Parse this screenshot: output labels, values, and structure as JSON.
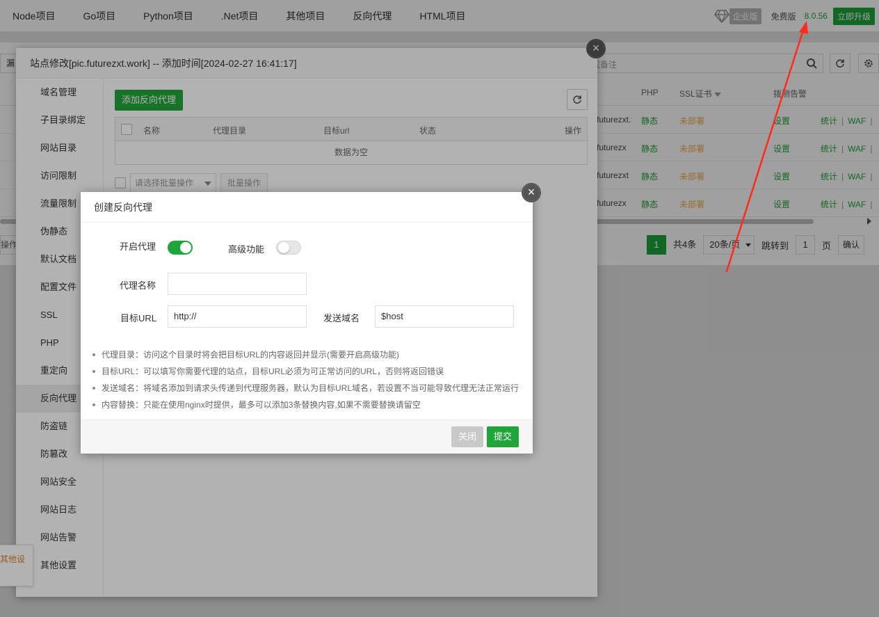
{
  "topnav": {
    "tabs": [
      "Node项目",
      "Go项目",
      "Python项目",
      ".Net项目",
      "其他项目",
      "反向代理",
      "HTML项目"
    ],
    "enterprise_badge": "企业版",
    "free_label": "免费版",
    "version": "8.0.56",
    "upgrade_label": "立即升级"
  },
  "background": {
    "left_button_text": "漏",
    "search_placeholder": "或备注",
    "columns": {
      "php": "PHP",
      "ssl": "SSL证书",
      "monitor": "拨测告警"
    },
    "rows": [
      {
        "domain": "futurezxt.v",
        "php": "静态",
        "ssl": "未部署",
        "settings": "设置",
        "stats": "统计",
        "waf": "WAF"
      },
      {
        "domain": "futurezx",
        "php": "静态",
        "ssl": "未部署",
        "settings": "设置",
        "stats": "统计",
        "waf": "WAF"
      },
      {
        "domain": "futurezxt",
        "php": "静态",
        "ssl": "未部署",
        "settings": "设置",
        "stats": "统计",
        "waf": "WAF"
      },
      {
        "domain": "futurezx",
        "php": "静态",
        "ssl": "未部署",
        "settings": "设置",
        "stats": "统计",
        "waf": "WAF"
      }
    ],
    "left_op_text": "操作",
    "pager": {
      "current": "1",
      "total": "共4条",
      "page_size": "20条/页",
      "jump_label": "跳转到",
      "jump_value": "1",
      "page_unit": "页",
      "confirm": "确认"
    }
  },
  "site_modal": {
    "title": "站点修改[pic.futurezxt.work] -- 添加时间[2024-02-27 16:41:17]",
    "sidebar": [
      "域名管理",
      "子目录绑定",
      "网站目录",
      "访问限制",
      "流量限制",
      "伪静态",
      "默认文档",
      "配置文件",
      "SSL",
      "PHP",
      "重定向",
      "反向代理",
      "防盗链",
      "防篡改",
      "网站安全",
      "网站日志",
      "网站告警",
      "其他设置"
    ],
    "active_item": "反向代理",
    "add_button": "添加反向代理",
    "table_headers": [
      "名称",
      "代理目录",
      "目标url",
      "状态",
      "操作"
    ],
    "empty_text": "数据为空",
    "batch_placeholder": "请选择批量操作",
    "batch_button": "批量操作",
    "side_tip": "其他设"
  },
  "proxy_modal": {
    "title": "创建反向代理",
    "enable_label": "开启代理",
    "enable_on": true,
    "advanced_label": "高级功能",
    "advanced_on": false,
    "name_label": "代理名称",
    "name_value": "",
    "target_label": "目标URL",
    "target_value": "http://",
    "send_domain_label": "发送域名",
    "send_domain_value": "$host",
    "notes": [
      "代理目录：访问这个目录时将会把目标URL的内容返回并显示(需要开启高级功能)",
      "目标URL：可以填写你需要代理的站点，目标URL必须为可正常访问的URL，否则将返回错误",
      "发送域名：将域名添加到请求头传递到代理服务器，默认为目标URL域名，若设置不当可能导致代理无法正常运行",
      "内容替换：只能在使用nginx时提供，最多可以添加3条替换内容,如果不需要替换请留空"
    ],
    "close_button": "关闭",
    "submit_button": "提交"
  },
  "colors": {
    "brand_green": "#20a53a",
    "warning_orange": "#f0ad4e",
    "annotation_red": "#ff2a1a"
  }
}
